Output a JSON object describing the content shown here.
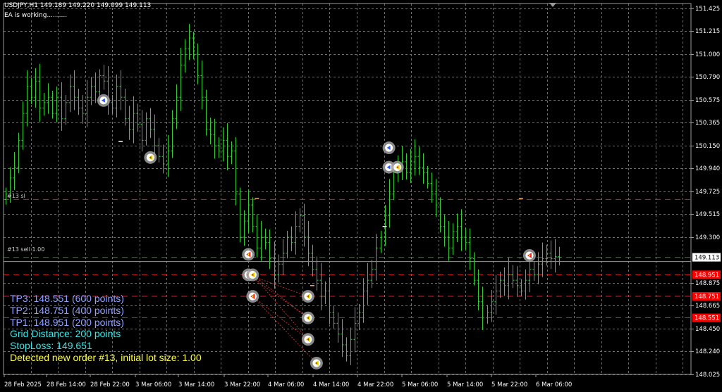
{
  "header": {
    "symbol_line": "USDJPY,H1  149.189 149.220 149.099 149.113",
    "status_text": "EA is working.........."
  },
  "line_labels": {
    "stoploss_label": "#13 sl",
    "entry_label": "#13 sell 1.00"
  },
  "info_panel": {
    "lines": [
      {
        "text": "TP3: 148.551 (600 points)",
        "color": "#8fa0ff"
      },
      {
        "text": "TP2: 148.751 (400 points)",
        "color": "#8fa0ff"
      },
      {
        "text": "TP1: 148.951 (200 points)",
        "color": "#8fa0ff"
      },
      {
        "text": "Grid Distance: 200 points",
        "color": "#39e6e6"
      },
      {
        "text": "StopLoss: 149.651",
        "color": "#39e6e6"
      },
      {
        "text": "Detected new order #13, initial lot size: 1.00",
        "color": "#ffff40"
      }
    ]
  },
  "price_axis": {
    "ticks": [
      "151.425",
      "151.215",
      "151.000",
      "150.790",
      "150.575",
      "150.365",
      "150.150",
      "149.940",
      "149.725",
      "149.515",
      "149.300",
      "148.875",
      "148.665",
      "148.450",
      "148.240",
      "148.025"
    ],
    "current_price": "149.113",
    "tp_badges": [
      "148.951",
      "148.751",
      "148.551"
    ]
  },
  "time_axis": {
    "ticks": [
      "28 Feb 2025",
      "28 Feb 14:00",
      "28 Feb 22:00",
      "3 Mar 06:00",
      "3 Mar 14:00",
      "3 Mar 22:00",
      "4 Mar 06:00",
      "4 Mar 14:00",
      "4 Mar 22:00",
      "5 Mar 06:00",
      "5 Mar 14:00",
      "5 Mar 22:00",
      "6 Mar 06:00"
    ]
  },
  "colors": {
    "background": "#000000",
    "grid": "#6e6e6e",
    "bars": "#33cc33",
    "stoploss_line": "#d02020",
    "tp_line": "#d02020",
    "entry_line": "#228b22",
    "badge_red": "#ff0000",
    "axis_text": "#ffffff"
  },
  "chart_data": {
    "type": "ohlc",
    "symbol": "USDJPY",
    "timeframe": "H1",
    "ohlc_header": {
      "open": 149.189,
      "high": 149.22,
      "low": 149.099,
      "close": 149.113
    },
    "ylim": [
      148.025,
      151.425
    ],
    "levels": {
      "stoploss": 149.651,
      "entry": 149.113,
      "tp1": 148.951,
      "tp2": 148.751,
      "tp3": 148.551
    },
    "close_series": [
      149.7,
      149.85,
      149.95,
      150.2,
      150.45,
      150.7,
      150.6,
      150.75,
      150.5,
      150.55,
      150.6,
      150.45,
      150.6,
      150.4,
      150.55,
      150.7,
      150.6,
      150.5,
      150.45,
      150.6,
      150.7,
      150.65,
      150.8,
      150.75,
      150.55,
      150.5,
      150.7,
      150.6,
      150.4,
      150.3,
      150.45,
      150.35,
      150.2,
      150.4,
      150.3,
      150.15,
      150.05,
      149.98,
      150.1,
      150.4,
      150.6,
      150.9,
      151.05,
      151.15,
      151.0,
      150.8,
      150.6,
      150.3,
      150.25,
      150.15,
      150.1,
      150.2,
      150.05,
      150.1,
      149.7,
      149.3,
      149.45,
      149.6,
      149.4,
      149.2,
      149.3,
      149.25,
      149.1,
      148.95,
      149.05,
      149.15,
      149.3,
      149.25,
      149.4,
      149.5,
      149.3,
      149.15,
      149.0,
      148.9,
      148.75,
      148.8,
      148.6,
      148.5,
      148.4,
      148.3,
      148.2,
      148.35,
      148.5,
      148.6,
      148.8,
      148.9,
      149.0,
      149.2,
      149.3,
      149.5,
      149.7,
      149.9,
      149.95,
      150.0,
      149.9,
      150.0,
      150.05,
      149.95,
      149.9,
      149.8,
      149.7,
      149.6,
      149.4,
      149.3,
      149.2,
      149.35,
      149.4,
      149.3,
      149.25,
      149.1,
      148.9,
      148.7,
      148.55,
      148.6,
      148.7,
      148.8,
      148.9,
      148.85,
      148.95,
      148.9,
      148.85,
      148.8,
      148.9,
      149.0,
      148.95,
      149.05,
      149.1,
      149.15,
      149.1,
      149.12,
      149.11
    ],
    "markers": [
      {
        "index": 23,
        "price": 150.57,
        "arrow": "blue"
      },
      {
        "index": 34,
        "price": 150.04,
        "arrow": "yellow"
      },
      {
        "index": 57,
        "price": 149.14,
        "arrow": "red"
      },
      {
        "index": 57,
        "price": 148.95,
        "arrow": "red"
      },
      {
        "index": 58,
        "price": 148.95,
        "arrow": "yellow"
      },
      {
        "index": 58,
        "price": 148.75,
        "arrow": "red"
      },
      {
        "index": 71,
        "price": 148.75,
        "arrow": "yellow"
      },
      {
        "index": 71,
        "price": 148.55,
        "arrow": "yellow"
      },
      {
        "index": 71,
        "price": 148.35,
        "arrow": "yellow"
      },
      {
        "index": 73,
        "price": 148.13,
        "arrow": "yellow"
      },
      {
        "index": 90,
        "price": 150.13,
        "arrow": "blue"
      },
      {
        "index": 90,
        "price": 149.95,
        "arrow": "blue"
      },
      {
        "index": 92,
        "price": 149.95,
        "arrow": "yellow"
      },
      {
        "index": 123,
        "price": 149.13,
        "arrow": "red"
      }
    ]
  }
}
